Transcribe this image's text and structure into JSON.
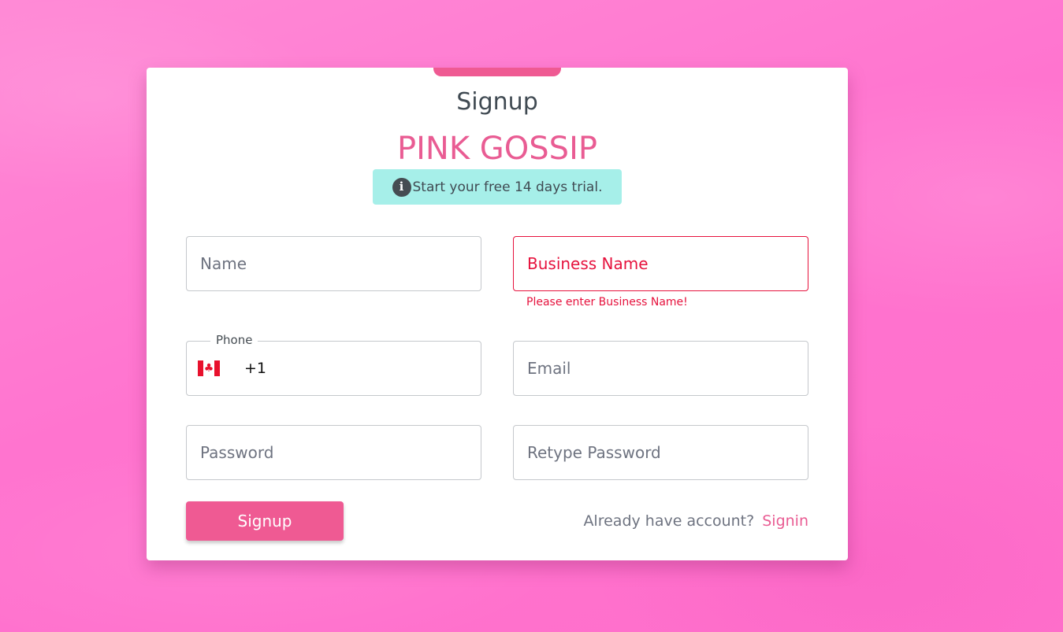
{
  "page": {
    "background_color": "#ff7ad0"
  },
  "form": {
    "title": "Signup",
    "brand": "PINK GOSSIP",
    "trial_message": "Start your free 14 days trial.",
    "trial_icon": "info-icon",
    "fields": {
      "name": {
        "placeholder": "Name"
      },
      "business_name": {
        "placeholder": "Business Name",
        "error": "Please enter Business Name!"
      },
      "phone": {
        "label": "Phone",
        "country_flag": "canada-flag-icon",
        "dial_code": "+1"
      },
      "email": {
        "placeholder": "Email"
      },
      "password": {
        "placeholder": "Password"
      },
      "retype_password": {
        "placeholder": "Retype Password"
      }
    },
    "signup_button": "Signup",
    "signin_prompt": "Already have account?",
    "signin_link": "Signin"
  },
  "colors": {
    "accent": "#ef5a93",
    "brand": "#e95c93",
    "error": "#e6123d",
    "trial_badge": "#a6efe9",
    "text": "#404a52"
  }
}
